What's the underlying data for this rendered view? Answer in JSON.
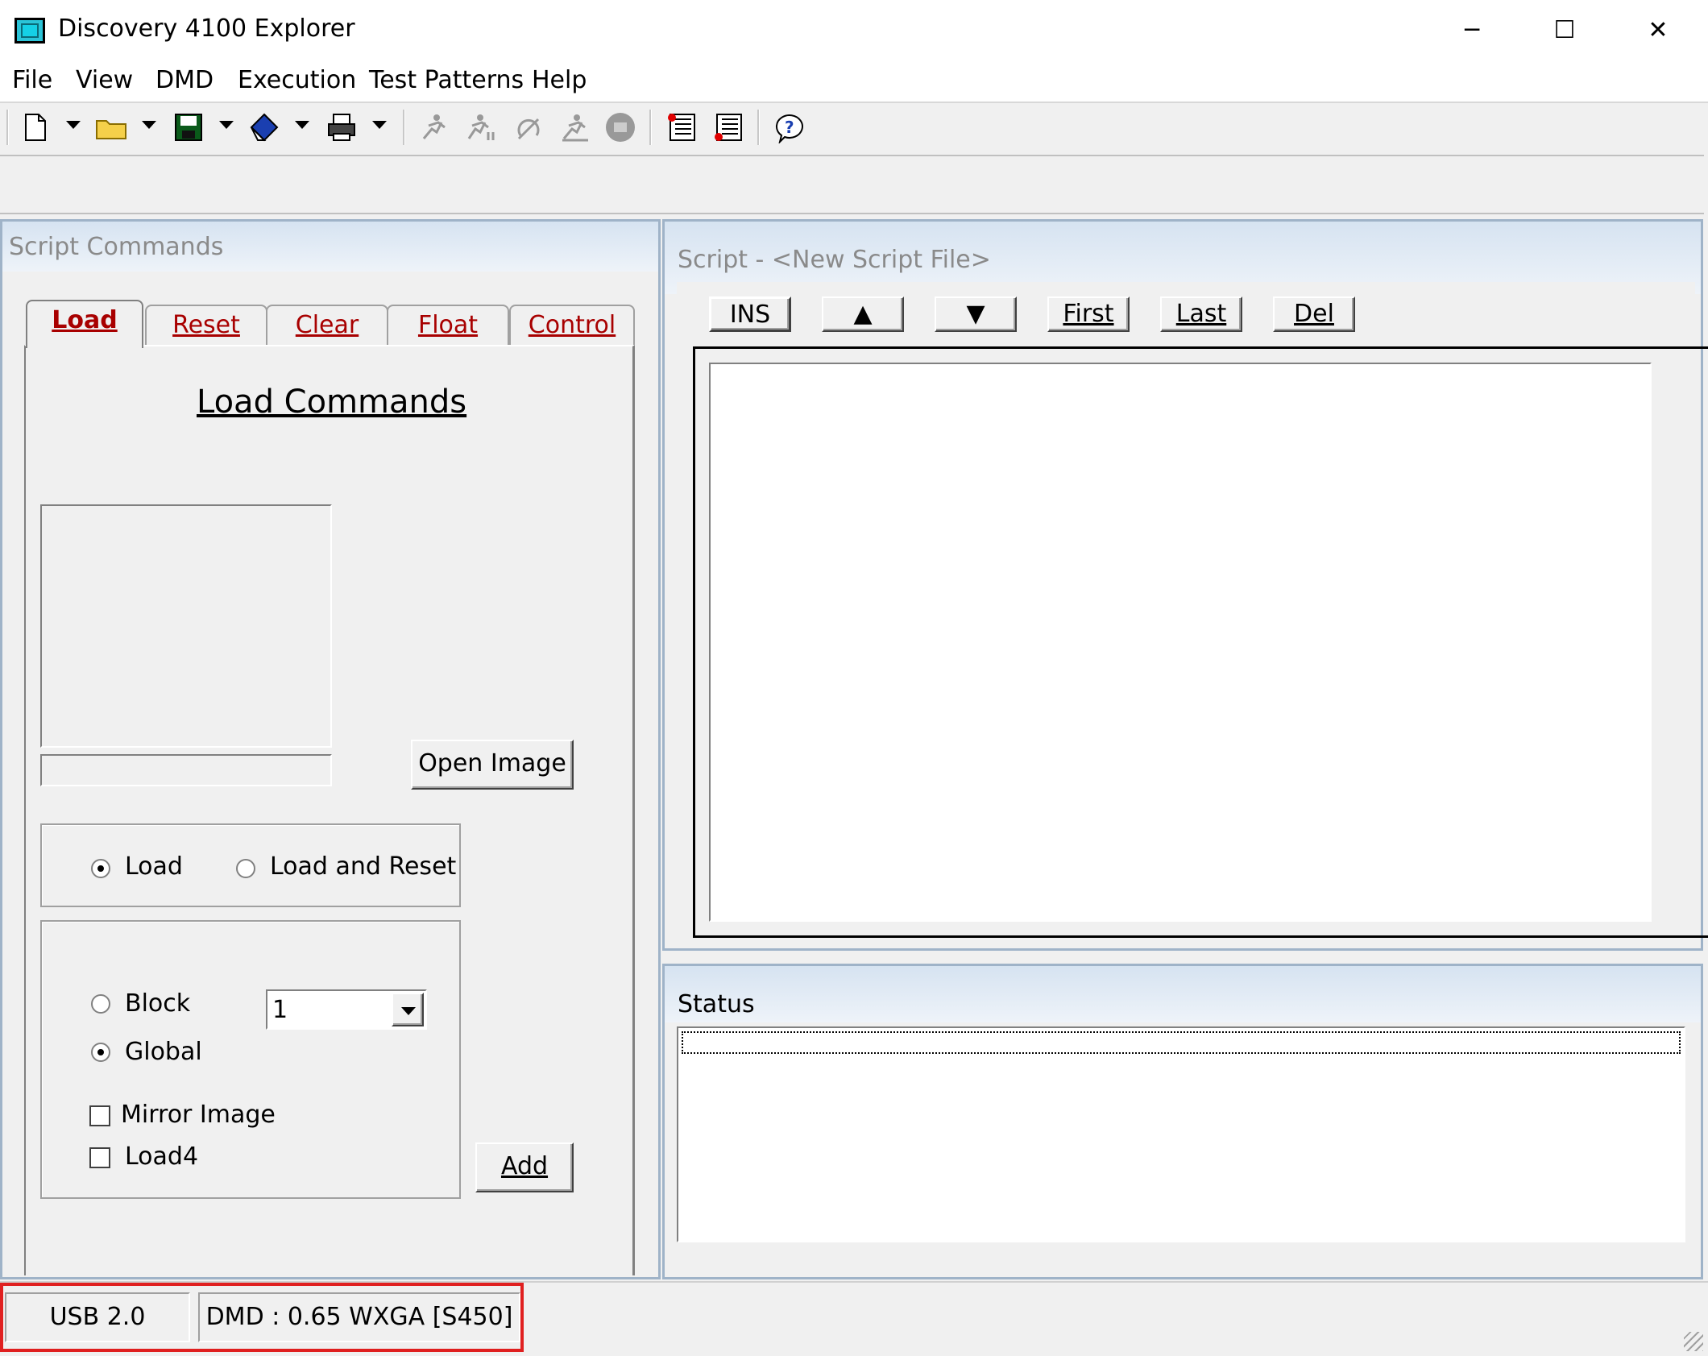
{
  "window": {
    "title": "Discovery 4100 Explorer",
    "minimize": "─",
    "maximize": "☐",
    "close": "✕"
  },
  "menu": {
    "items": [
      "File",
      "View",
      "DMD",
      "Execution",
      "Test Patterns",
      "Help"
    ]
  },
  "toolbar": {
    "icons": [
      "new-file-icon",
      "open-folder-icon",
      "save-icon",
      "erase-icon",
      "print-icon",
      "run-icon",
      "run-step-icon",
      "reset-icon",
      "step-icon",
      "stop-icon",
      "script-red-icon",
      "script-list-icon",
      "help-icon"
    ]
  },
  "script_commands": {
    "title": "Script Commands",
    "tabs": [
      "Load",
      "Reset",
      "Clear",
      "Float",
      "Control"
    ],
    "active_tab": "Load",
    "heading": "Load Commands",
    "open_image": "Open Image",
    "mode_load": "Load",
    "mode_load_reset": "Load and Reset",
    "block": "Block",
    "global": "Global",
    "block_value": "1",
    "mirror_image": "Mirror Image",
    "load4": "Load4",
    "add": "Add"
  },
  "script": {
    "title": "Script - <New Script File>",
    "buttons": {
      "ins": "INS",
      "up": "▲",
      "down": "▼",
      "first": "First",
      "last": "Last",
      "del": "Del"
    }
  },
  "status": {
    "title": "Status"
  },
  "statusbar": {
    "usb": "USB 2.0",
    "dmd": "DMD : 0.65 WXGA [S450]"
  },
  "colors": {
    "tab_text": "#a80000",
    "panel_border": "#9fb3c8",
    "highlight": "#e02020"
  }
}
